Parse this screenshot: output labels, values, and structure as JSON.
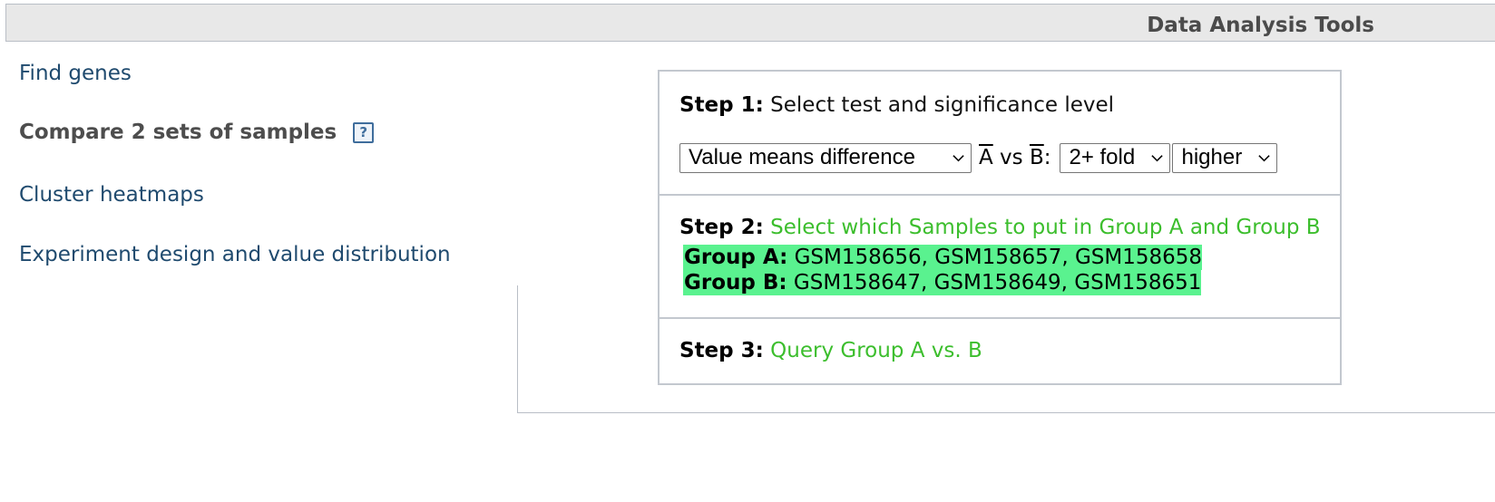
{
  "header": {
    "title": "Data Analysis Tools"
  },
  "nav": {
    "items": [
      {
        "label": "Find genes"
      },
      {
        "label": "Compare 2 sets of samples",
        "help": "?"
      },
      {
        "label": "Cluster heatmaps"
      },
      {
        "label": "Experiment design and value distribution"
      }
    ]
  },
  "step1": {
    "label": "Step 1:",
    "text": "Select test and significance level",
    "test_select": "Value means difference",
    "compare_text": {
      "a": "A",
      "vs": " vs ",
      "b": "B",
      "colon": ":"
    },
    "fold_select": "2+ fold",
    "direction_select": "higher"
  },
  "step2": {
    "label": "Step 2:",
    "link": "Select which Samples to put in Group A and Group B",
    "group_a_label": "Group A:",
    "group_a_samples": "GSM158656, GSM158657, GSM158658",
    "group_b_label": "Group B:",
    "group_b_samples": "GSM158647, GSM158649, GSM158651"
  },
  "step3": {
    "label": "Step 3:",
    "link": "Query Group A vs. B"
  },
  "colors": {
    "link_green": "#3cbe2d",
    "group_highlight": "#5af28f",
    "nav_link": "#1f4a6e"
  }
}
